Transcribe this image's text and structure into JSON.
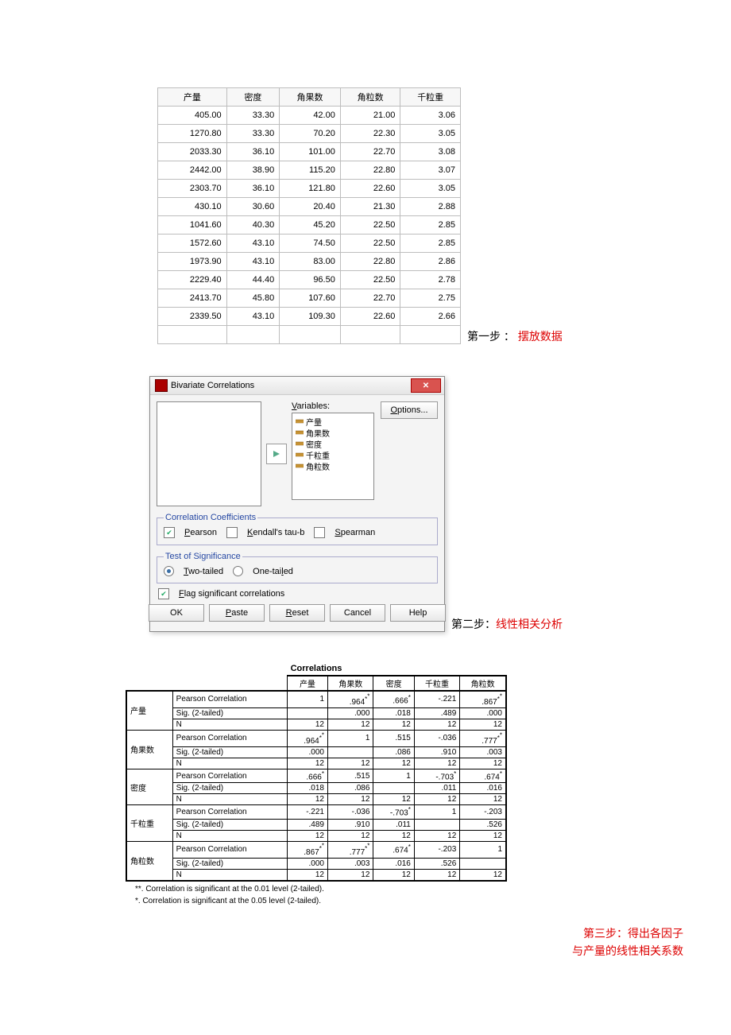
{
  "data_table": {
    "headers": [
      "产量",
      "密度",
      "角果数",
      "角粒数",
      "千粒重"
    ],
    "rows": [
      [
        "405.00",
        "33.30",
        "42.00",
        "21.00",
        "3.06"
      ],
      [
        "1270.80",
        "33.30",
        "70.20",
        "22.30",
        "3.05"
      ],
      [
        "2033.30",
        "36.10",
        "101.00",
        "22.70",
        "3.08"
      ],
      [
        "2442.00",
        "38.90",
        "115.20",
        "22.80",
        "3.07"
      ],
      [
        "2303.70",
        "36.10",
        "121.80",
        "22.60",
        "3.05"
      ],
      [
        "430.10",
        "30.60",
        "20.40",
        "21.30",
        "2.88"
      ],
      [
        "1041.60",
        "40.30",
        "45.20",
        "22.50",
        "2.85"
      ],
      [
        "1572.60",
        "43.10",
        "74.50",
        "22.50",
        "2.85"
      ],
      [
        "1973.90",
        "43.10",
        "83.00",
        "22.80",
        "2.86"
      ],
      [
        "2229.40",
        "44.40",
        "96.50",
        "22.50",
        "2.78"
      ],
      [
        "2413.70",
        "45.80",
        "107.60",
        "22.70",
        "2.75"
      ],
      [
        "2339.50",
        "43.10",
        "109.30",
        "22.60",
        "2.66"
      ]
    ]
  },
  "step1": {
    "prefix": "第一步 ： ",
    "text": "摆放数据"
  },
  "dialog": {
    "title": "Bivariate Correlations",
    "options_label": "Options...",
    "vars_label": "Variables:",
    "vars": [
      "产量",
      "角果数",
      "密度",
      "千粒重",
      "角粒数"
    ],
    "group_cc": "Correlation Coefficients",
    "cb_pearson": "Pearson",
    "cb_kendall": "Kendall's tau-b",
    "cb_spearman": "Spearman",
    "group_sig": "Test of Significance",
    "rb_two": "Two-tailed",
    "rb_one": "One-tailed",
    "cb_flag": "Flag significant correlations",
    "btns": {
      "ok": "OK",
      "paste": "Paste",
      "reset": "Reset",
      "cancel": "Cancel",
      "help": "Help"
    }
  },
  "step2": {
    "prefix": "第二步：",
    "text": "线性相关分析"
  },
  "corr": {
    "title": "Correlations",
    "col_headers": [
      "产量",
      "角果数",
      "密度",
      "千粒重",
      "角粒数"
    ],
    "row_labels": {
      "pc": "Pearson Correlation",
      "sig": "Sig. (2-tailed)",
      "n": "N"
    },
    "vars": [
      "产量",
      "角果数",
      "密度",
      "千粒重",
      "角粒数"
    ],
    "groups": [
      {
        "var": "产量",
        "pc": [
          "1",
          ".964**",
          ".666*",
          "-.221",
          ".867**"
        ],
        "sig": [
          "",
          ".000",
          ".018",
          ".489",
          ".000"
        ],
        "n": [
          "12",
          "12",
          "12",
          "12",
          "12"
        ]
      },
      {
        "var": "角果数",
        "pc": [
          ".964**",
          "1",
          ".515",
          "-.036",
          ".777**"
        ],
        "sig": [
          ".000",
          "",
          ".086",
          ".910",
          ".003"
        ],
        "n": [
          "12",
          "12",
          "12",
          "12",
          "12"
        ]
      },
      {
        "var": "密度",
        "pc": [
          ".666*",
          ".515",
          "1",
          "-.703*",
          ".674*"
        ],
        "sig": [
          ".018",
          ".086",
          "",
          ".011",
          ".016"
        ],
        "n": [
          "12",
          "12",
          "12",
          "12",
          "12"
        ]
      },
      {
        "var": "千粒重",
        "pc": [
          "-.221",
          "-.036",
          "-.703*",
          "1",
          "-.203"
        ],
        "sig": [
          ".489",
          ".910",
          ".011",
          "",
          ".526"
        ],
        "n": [
          "12",
          "12",
          "12",
          "12",
          "12"
        ]
      },
      {
        "var": "角粒数",
        "pc": [
          ".867**",
          ".777**",
          ".674*",
          "-.203",
          "1"
        ],
        "sig": [
          ".000",
          ".003",
          ".016",
          ".526",
          ""
        ],
        "n": [
          "12",
          "12",
          "12",
          "12",
          "12"
        ]
      }
    ],
    "foot1": "**. Correlation is significant at the 0.01 level (2-tailed).",
    "foot2": "*. Correlation is significant at the 0.05 level (2-tailed)."
  },
  "step3": {
    "line1": "第三步：得出各因子",
    "line2": "与产量的线性相关系数"
  }
}
